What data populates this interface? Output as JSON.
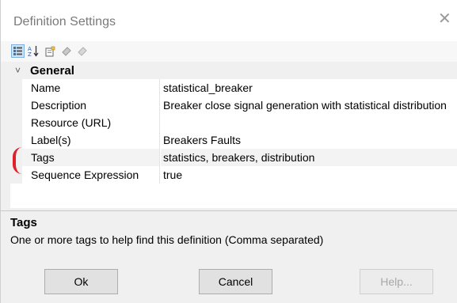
{
  "window": {
    "title": "Definition Settings",
    "close_glyph": "✕"
  },
  "toolbar": {
    "icons": [
      "categorized-view-icon",
      "alphabetical-sort-icon",
      "property-pages-icon",
      "event-icon",
      "event-disabled-icon"
    ]
  },
  "grid": {
    "category": {
      "chevron": "˅",
      "label": "General"
    },
    "rows": [
      {
        "name": "Name",
        "value": "statistical_breaker"
      },
      {
        "name": "Description",
        "value": "Breaker close signal generation with statistical distribution"
      },
      {
        "name": "Resource (URL)",
        "value": ""
      },
      {
        "name": "Label(s)",
        "value": "Breakers Faults"
      },
      {
        "name": "Tags",
        "value": "statistics, breakers, distribution"
      },
      {
        "name": "Sequence Expression",
        "value": "true"
      }
    ]
  },
  "description_panel": {
    "heading": "Tags",
    "text": "One or more tags to help find this definition (Comma separated)"
  },
  "buttons": {
    "ok": "Ok",
    "cancel": "Cancel",
    "help": "Help..."
  },
  "colors": {
    "annotation_mark": "#e0202a",
    "toolbar_active": "#cde4f7"
  }
}
